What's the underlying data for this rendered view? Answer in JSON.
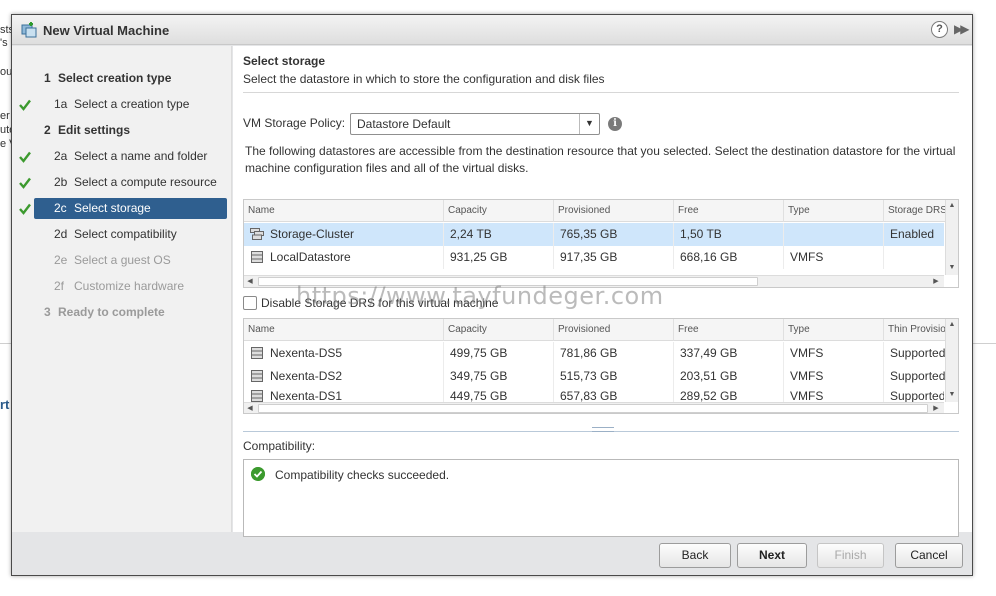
{
  "background": {
    "fragments": [
      "sts",
      "'s",
      "ou",
      "er",
      "ute",
      "e V",
      "rt"
    ]
  },
  "dialog": {
    "title": "New Virtual Machine",
    "help": "?"
  },
  "nav": {
    "items": [
      {
        "num": "1",
        "label": "Select creation type"
      },
      {
        "num": "1a",
        "label": "Select a creation type"
      },
      {
        "num": "2",
        "label": "Edit settings"
      },
      {
        "num": "2a",
        "label": "Select a name and folder"
      },
      {
        "num": "2b",
        "label": "Select a compute resource"
      },
      {
        "num": "2c",
        "label": "Select storage"
      },
      {
        "num": "2d",
        "label": "Select compatibility"
      },
      {
        "num": "2e",
        "label": "Select a guest OS"
      },
      {
        "num": "2f",
        "label": "Customize hardware"
      },
      {
        "num": "3",
        "label": "Ready to complete"
      }
    ]
  },
  "main": {
    "title": "Select storage",
    "subtitle": "Select the datastore in which to store the configuration and disk files",
    "policy_label": "VM Storage Policy:",
    "policy_value": "Datastore Default",
    "description": "The following datastores are accessible from the destination resource that you selected. Select the destination datastore for the virtual machine configuration files and all of the virtual disks.",
    "table1": {
      "columns": [
        "Name",
        "Capacity",
        "Provisioned",
        "Free",
        "Type",
        "Storage DRS"
      ],
      "rows": [
        [
          "Storage-Cluster",
          "2,24 TB",
          "765,35 GB",
          "1,50 TB",
          "",
          "Enabled"
        ],
        [
          "LocalDatastore",
          "931,25 GB",
          "917,35 GB",
          "668,16 GB",
          "VMFS",
          ""
        ]
      ]
    },
    "drs_label": "Disable Storage DRS for this virtual machine",
    "table2": {
      "columns": [
        "Name",
        "Capacity",
        "Provisioned",
        "Free",
        "Type",
        "Thin Provisioning"
      ],
      "rows": [
        [
          "Nexenta-DS5",
          "499,75 GB",
          "781,86 GB",
          "337,49 GB",
          "VMFS",
          "Supported"
        ],
        [
          "Nexenta-DS2",
          "349,75 GB",
          "515,73 GB",
          "203,51 GB",
          "VMFS",
          "Supported"
        ],
        [
          "Nexenta-DS1",
          "449,75 GB",
          "657,83 GB",
          "289,52 GB",
          "VMFS",
          "Supported"
        ]
      ]
    },
    "compat_label": "Compatibility:",
    "compat_message": "Compatibility checks succeeded."
  },
  "buttons": {
    "back": "Back",
    "next": "Next",
    "finish": "Finish",
    "cancel": "Cancel"
  },
  "watermark": "https://www.tayfundeger.com",
  "colors": {
    "active_nav": "#2f5f8f",
    "selected_row": "#cfe6fb",
    "check": "#3c9a2e"
  }
}
